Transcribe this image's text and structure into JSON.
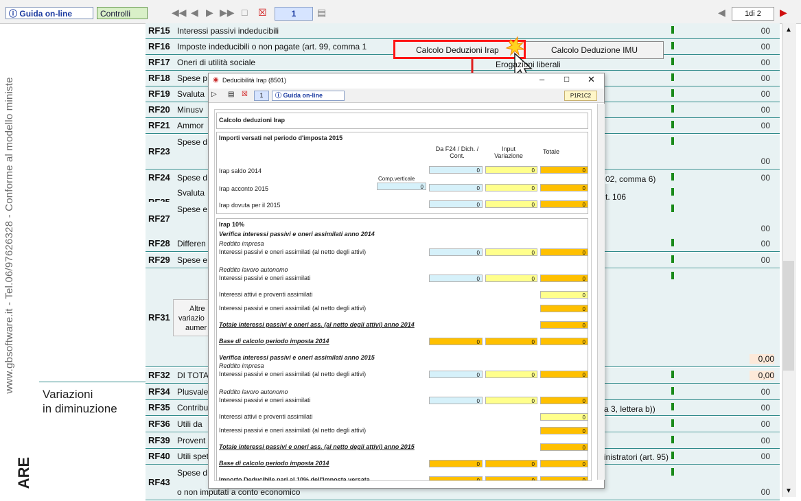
{
  "toolbar": {
    "guida_label": "Guida on-line",
    "controlli_label": "Controlli",
    "page_value": "1",
    "page_count": "1di 2"
  },
  "side": {
    "vertical_text": "www.gbsoftware.it - Tel.06/97626328 - Conforme al modello ministe",
    "brand_fragment": "ARE",
    "variazioni_line1": "Variazioni",
    "variazioni_line2": "in diminuzione"
  },
  "rows": [
    {
      "code": "RF15",
      "desc": "Interessi passivi indeducibili"
    },
    {
      "code": "RF16",
      "desc": "Imposte indeducibili o non pagate (art. 99, comma 1"
    },
    {
      "code": "RF17",
      "desc": "Oneri di utilità sociale"
    },
    {
      "code": "RF18",
      "desc": "Spese p"
    },
    {
      "code": "RF19",
      "desc": "Svaluta"
    },
    {
      "code": "RF20",
      "desc": "Minusv"
    },
    {
      "code": "RF21",
      "desc": "Ammor"
    },
    {
      "code": "RF23",
      "desc": "Spese d o di cor"
    },
    {
      "code": "RF24",
      "desc": "Spese d"
    },
    {
      "code": "RF25",
      "desc": "Svaluta"
    },
    {
      "code": "RF27",
      "desc": "Spese e"
    },
    {
      "code": "RF28",
      "desc": "Differen"
    },
    {
      "code": "RF29",
      "desc": "Spese e"
    },
    {
      "code": "RF31",
      "desc": ""
    },
    {
      "code": "RF32",
      "desc": "DI TOTA"
    },
    {
      "code": "RF34",
      "desc": "Plusvale"
    },
    {
      "code": "RF35",
      "desc": "Contribu"
    },
    {
      "code": "RF36",
      "desc": "Utili da"
    },
    {
      "code": "RF39",
      "desc": "Provent"
    },
    {
      "code": "RF40",
      "desc": "Utili spet"
    },
    {
      "code": "RF43",
      "desc": "Spese d ed altri"
    }
  ],
  "form_text": {
    "erogazioni": "Erogazioni liberali",
    "rf24_right": "02, comma 6)",
    "rf25_right": "t. 106",
    "rf35_right": "a 3, lettera b))",
    "rf40_right": "inistratori (art. 95)",
    "bottom_line": "o non imputati a conto economico",
    "altre_1": "Altre",
    "altre_2": "variazio",
    "altre_3": "aumer",
    "zero": "00",
    "zero_comma": ",00",
    "zero_total": "0,00"
  },
  "menu": {
    "item1": "Calcolo Deduzioni Irap",
    "item2": "Calcolo Deduzione IMU"
  },
  "dialog": {
    "title": "Deducibilità Irap (8501)",
    "page": "1",
    "guida": "Guida on-line",
    "code": "P1R1C2",
    "heading": "Calcolo deduzioni Irap",
    "sec1_title": "Importi versati nel periodo d'imposta 2015",
    "col1": "Da F24 / Dich. / Cont.",
    "col2": "Input Variazione",
    "col3": "Totale",
    "comp_verticale": "Comp.verticale",
    "irap_saldo": "Irap saldo 2014",
    "irap_acconto": "Irap acconto 2015",
    "irap_dovuta": "Irap dovuta per il 2015",
    "irap10": "Irap 10%",
    "verifica2014": "Verifica interessi passivi e oneri assimilati anno 2014",
    "reddito_impresa": "Reddito impresa",
    "int_passivi_netto": "Interessi passivi e oneri assimilati (al netto degli attivi)",
    "reddito_lavoro": "Reddito lavoro autonomo",
    "int_passivi": "Interessi passivi e oneri assimilati",
    "int_attivi": "Interessi attivi e proventi assimilati",
    "totale2014": "Totale interessi passivi e oneri ass. (al netto degli attivi) anno 2014",
    "base2014": "Base di calcolo periodo imposta 2014",
    "verifica2015": "Verifica interessi passivi e oneri assimilati anno 2015",
    "totale2015": "Totale interessi passivi e oneri ass. (al netto degli attivi) anno 2015",
    "importo10": "Importo Deducibile pari al 10% dell'imposta versata",
    "zero": "0",
    "cents": "00"
  },
  "colors": {
    "accent_red": "#ff1414",
    "row_teal": "#2f8a8a",
    "cell_orange": "#ffc000",
    "cell_yellow": "#ffff8c",
    "cell_blue": "#d6f1fa"
  }
}
